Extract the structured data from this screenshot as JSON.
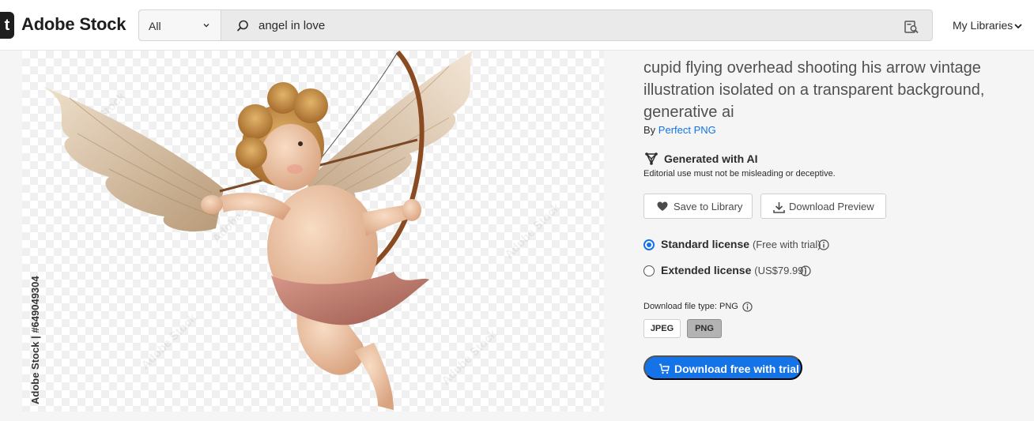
{
  "header": {
    "logo_mark": "t",
    "logo_text": "Adobe Stock",
    "search_category": "All",
    "search_query": "angel in love",
    "my_libraries": "My Libraries"
  },
  "image": {
    "watermark_id": "Adobe Stock | #649049304",
    "watermark_text": "Adobe Stock"
  },
  "asset": {
    "title": "cupid flying overhead shooting his arrow vintage illustration isolated on a transparent background, generative ai",
    "by_prefix": "By ",
    "author": "Perfect PNG",
    "ai_label": "Generated with AI",
    "ai_note": "Editorial use must not be misleading or deceptive."
  },
  "actions": {
    "save_label": "Save to Library",
    "download_preview_label": "Download Preview"
  },
  "licenses": [
    {
      "name": "Standard license",
      "detail": "(Free with trial)",
      "selected": true
    },
    {
      "name": "Extended license",
      "detail": "(US$79.99)",
      "selected": false
    }
  ],
  "file_type": {
    "label": "Download file type: PNG",
    "options": [
      "JPEG",
      "PNG"
    ],
    "selected": "PNG"
  },
  "cta": {
    "label": "Download free with trial"
  },
  "colors": {
    "accent": "#1473e6",
    "link": "#1473e6"
  }
}
